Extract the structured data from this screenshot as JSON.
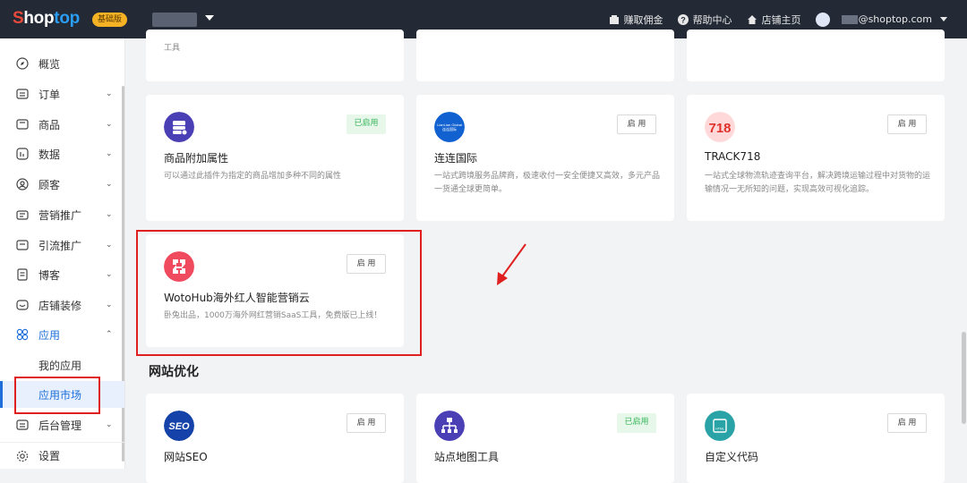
{
  "topbar": {
    "logo_part1": "S",
    "logo_part2": "hop",
    "logo_part3": "top",
    "plan_badge": "基础版",
    "earn": "赚取佣金",
    "help": "帮助中心",
    "store_home": "店铺主页",
    "email": "@shoptop.com"
  },
  "sidebar": {
    "items": [
      {
        "label": "概览",
        "icon": "compass-icon"
      },
      {
        "label": "订单",
        "icon": "order-icon"
      },
      {
        "label": "商品",
        "icon": "product-icon"
      },
      {
        "label": "数据",
        "icon": "data-icon"
      },
      {
        "label": "顾客",
        "icon": "customer-icon"
      },
      {
        "label": "营销推广",
        "icon": "marketing-icon"
      },
      {
        "label": "引流推广",
        "icon": "traffic-icon"
      },
      {
        "label": "博客",
        "icon": "blog-icon"
      },
      {
        "label": "店铺装修",
        "icon": "decorate-icon"
      },
      {
        "label": "应用",
        "icon": "apps-icon"
      }
    ],
    "sub_items": [
      {
        "label": "我的应用"
      },
      {
        "label": "应用市场"
      }
    ],
    "bottom_items": [
      {
        "label": "后台管理",
        "icon": "admin-icon"
      },
      {
        "label": "设置",
        "icon": "gear-icon"
      }
    ]
  },
  "cards_top_partial": {
    "card1_desc": "工具"
  },
  "cards": [
    {
      "title": "商品附加属性",
      "desc": "可以通过此插件为指定的商品增加多种不同的属性",
      "button": "已启用",
      "enabled": true
    },
    {
      "title": "连连国际",
      "desc": "一站式跨境服务品牌商，极速收付一安全便捷又高效，多元产品一货通全球更简单。",
      "button": "启 用",
      "enabled": false,
      "icon_text_1": "LianLian Global",
      "icon_text_2": "连连国际"
    },
    {
      "title": "TRACK718",
      "desc": "一站式全球物流轨迹查询平台，解决跨境运输过程中对货物的运输情况一无所知的问题，实现高效可视化追踪。",
      "button": "启 用",
      "enabled": false,
      "icon_text": "718"
    },
    {
      "title": "WotoHub海外红人智能营销云",
      "desc": "卧兔出品，1000万海外网红营销SaaS工具，免费版已上线！",
      "button": "启 用",
      "enabled": false
    }
  ],
  "section": {
    "title": "网站优化"
  },
  "cards_bottom": [
    {
      "title": "网站SEO",
      "button": "启 用",
      "icon_text": "SEO"
    },
    {
      "title": "站点地图工具",
      "button": "已启用"
    },
    {
      "title": "自定义代码",
      "button": "启 用",
      "icon_text": "HTML"
    }
  ]
}
